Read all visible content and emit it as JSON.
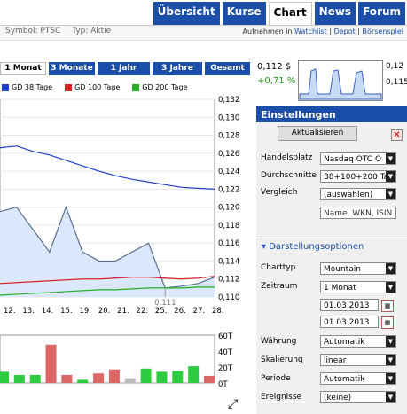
{
  "nav": {
    "tabs": [
      {
        "label": "Übersicht"
      },
      {
        "label": "Kurse"
      },
      {
        "label": "Chart"
      },
      {
        "label": "News"
      },
      {
        "label": "Forum"
      }
    ]
  },
  "info": {
    "symbol": "Symbol: PTSC",
    "typ": "Typ: Aktie",
    "watch_prefix": "Aufnehmen in",
    "watchlist": "Watchlist",
    "depot": "Depot",
    "boersenspiel": "Börsenspiel"
  },
  "ranges": [
    {
      "label": "1 Monat"
    },
    {
      "label": "3 Monate"
    },
    {
      "label": "1 Jahr"
    },
    {
      "label": "3 Jahre"
    },
    {
      "label": "Gesamt"
    }
  ],
  "quote": {
    "price": "0,112 $",
    "change": "+0,71 %",
    "spark_high": "0,12",
    "spark_low": "0,115"
  },
  "legend": [
    {
      "label": "GD 38 Tage",
      "color": "#1f3ec8"
    },
    {
      "label": "GD 100 Tage",
      "color": "#d42020"
    },
    {
      "label": "GD 200 Tage",
      "color": "#22b022"
    }
  ],
  "chart_data": {
    "type": "area",
    "x": [
      "12.",
      "13.",
      "14.",
      "15.",
      "19.",
      "20.",
      "21.",
      "22.",
      "25.",
      "26.",
      "27.",
      "28."
    ],
    "series": [
      {
        "name": "Kurs",
        "values": [
          0.1195,
          0.12,
          0.1175,
          0.115,
          0.12,
          0.115,
          0.114,
          0.114,
          0.115,
          0.116,
          0.111,
          0.1112,
          0.1115,
          0.1122
        ]
      },
      {
        "name": "GD 38 Tage",
        "values": [
          0.1266,
          0.1268,
          0.1262,
          0.1258,
          0.1252,
          0.1246,
          0.124,
          0.1235,
          0.1231,
          0.1228,
          0.1225,
          0.1222,
          0.1221,
          0.122
        ]
      },
      {
        "name": "GD 100 Tage",
        "values": [
          0.1115,
          0.1116,
          0.1117,
          0.1118,
          0.1119,
          0.112,
          0.112,
          0.1121,
          0.1122,
          0.1122,
          0.1121,
          0.112,
          0.1121,
          0.1123
        ]
      },
      {
        "name": "GD 200 Tage",
        "values": [
          0.1102,
          0.1103,
          0.1104,
          0.1105,
          0.1106,
          0.1107,
          0.1108,
          0.1108,
          0.1109,
          0.111,
          0.111,
          0.111,
          0.1111,
          0.1111
        ]
      }
    ],
    "yticks": [
      "0,132",
      "0,130",
      "0,128",
      "0,126",
      "0,124",
      "0,122",
      "0,120",
      "0,118",
      "0,116",
      "0,114",
      "0,112",
      "0,110"
    ],
    "ylim": [
      0.11,
      0.132
    ],
    "annotation": "0,111",
    "volume": {
      "values": [
        14,
        10,
        10,
        48,
        10,
        4,
        12,
        17,
        6,
        18,
        14,
        15,
        21,
        9
      ],
      "colors": [
        "#2ecc40",
        "#2ecc40",
        "#2ecc40",
        "#dd6666",
        "#dd6666",
        "#2ecc40",
        "#dd6666",
        "#dd6666",
        "#bbbbbb",
        "#2ecc40",
        "#2ecc40",
        "#2ecc40",
        "#2ecc40",
        "#dd6666"
      ],
      "yticks": [
        "60T",
        "40T",
        "20T",
        "0T"
      ],
      "ylim": [
        0,
        60
      ]
    }
  },
  "settings": {
    "title": "Einstellungen",
    "refresh": "Aktualisieren",
    "handelsplatz_label": "Handelsplatz",
    "handelsplatz": "Nasdaq OTC O",
    "durchschnitte_label": "Durchschnitte",
    "durchschnitte": "38+100+200 Ta",
    "vergleich_label": "Vergleich",
    "vergleich": "(auswählen)",
    "search_placeholder": "Name, WKN, ISIN",
    "darstellung": "Darstellungsoptionen",
    "charttyp_label": "Charttyp",
    "charttyp": "Mountain",
    "zeitraum_label": "Zeitraum",
    "zeitraum": "1 Monat",
    "date_from": "01.03.2013",
    "date_to": "01.03.2013",
    "waehrung_label": "Währung",
    "waehrung": "Automatik",
    "skalierung_label": "Skalierung",
    "skalierung": "linear",
    "periode_label": "Periode",
    "periode": "Automatik",
    "ereignisse_label": "Ereignisse",
    "ereignisse": "(keine)"
  }
}
